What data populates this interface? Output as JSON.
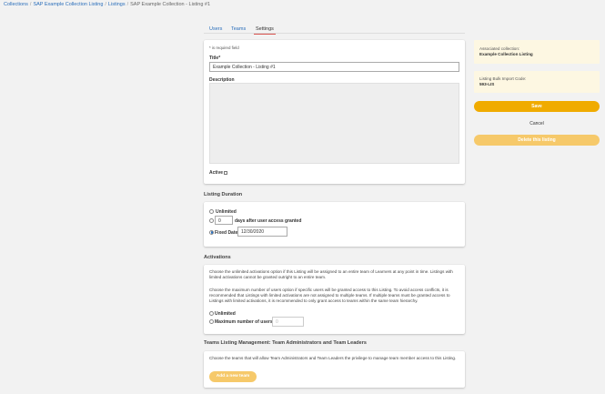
{
  "breadcrumb": {
    "items": [
      "Collections",
      "SAP Example Collection Listing",
      "Listings"
    ],
    "current": "SAP Example Collection - Listing #1",
    "separator": "/"
  },
  "tabs": [
    "Users",
    "Teams",
    "Settings"
  ],
  "active_tab": "Settings",
  "form": {
    "required_note": "* is required field",
    "title_label": "Title*",
    "title_value": "Example Collection - Listing #1",
    "description_label": "Description",
    "description_value": "",
    "active_label": "Active"
  },
  "duration": {
    "heading": "Listing Duration",
    "unlimited_label": "Unlimited",
    "days_value": "0",
    "days_label": "days after user access granted",
    "fixed_label": "Fixed Date",
    "fixed_value": "12/30/2020",
    "selected": "Fixed Date"
  },
  "activations": {
    "heading": "Activations",
    "para1": "Choose the unlimited activations option if this Listing will be assigned to an entire team of Learners at any point in time. Listings with limited activations cannot be granted outright to an entire team.",
    "para2": "Choose the maximum number of users option if specific users will be granted access to this Listing. To avoid access conflicts, it is recommended that Listings with limited activations are not assigned to multiple teams. If multiple teams must be granted access to Listings with limited activations, it is recommended to only grant access to teams within the same team hierarchy.",
    "unlimited_label": "Unlimited",
    "max_label": "Maximum number of users",
    "max_placeholder": "0"
  },
  "teams": {
    "heading": "Teams Listing Management: Team Administrators and Team Leaders",
    "para": "Choose the teams that will allow Team Administrators and Team Leaders the privilege to manage team member access to this Listing.",
    "add_label": "Add a new team"
  },
  "sidebar": {
    "assoc_title": "Associated collection:",
    "assoc_value": "Example Collection Listing",
    "bulk_title": "Listing Bulk Import Code:",
    "bulk_value": "593-LIS",
    "save_label": "Save",
    "cancel_label": "Cancel",
    "delete_label": "Delete this listing"
  }
}
